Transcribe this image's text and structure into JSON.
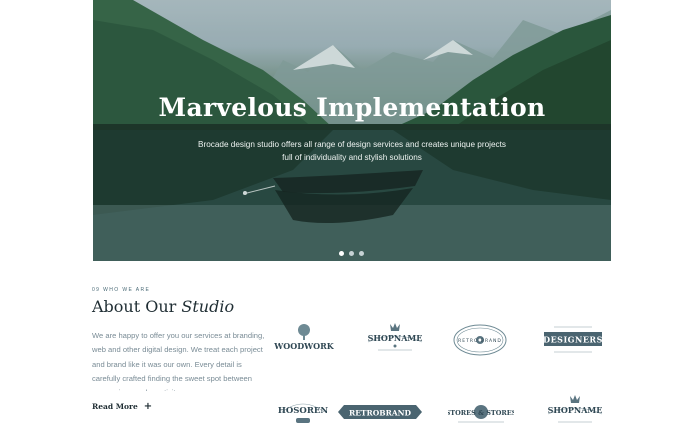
{
  "hero": {
    "title": "Marvelous Implementation",
    "subtitle": "Brocade design studio offers all range of design services and creates unique projects full of individuality and stylish solutions",
    "slides": 3,
    "active_slide": 1
  },
  "about": {
    "eyebrow": "09 WHO WE ARE",
    "title_plain": "About Our ",
    "title_italic": "Studio",
    "text": "We are happy to offer you our services at branding, web and other digital design. We treat each project and brand like it was our own. Every detail is carefully crafted finding the sweet spot between conversions and creativity.",
    "read_more": "Read More"
  },
  "clients": [
    {
      "name": "WOODWORK",
      "icon": "tree-icon"
    },
    {
      "name": "SHOPNAME",
      "icon": "crown-icon"
    },
    {
      "name": "RETRO BRAND",
      "icon": "gear-icon"
    },
    {
      "name": "DESIGNERS",
      "icon": "ribbon-icon"
    },
    {
      "name": "HOSOREN",
      "icon": "badge-icon"
    },
    {
      "name": "RETROBRAND",
      "icon": "banner-icon"
    },
    {
      "name": "STORES & STORES",
      "icon": "ampersand-icon"
    },
    {
      "name": "SHOPNAME",
      "icon": "crown-icon"
    }
  ],
  "colors": {
    "accent": "#2f4753",
    "hero_overlay": "#2a4a3a",
    "text_muted": "#7a8c96"
  }
}
